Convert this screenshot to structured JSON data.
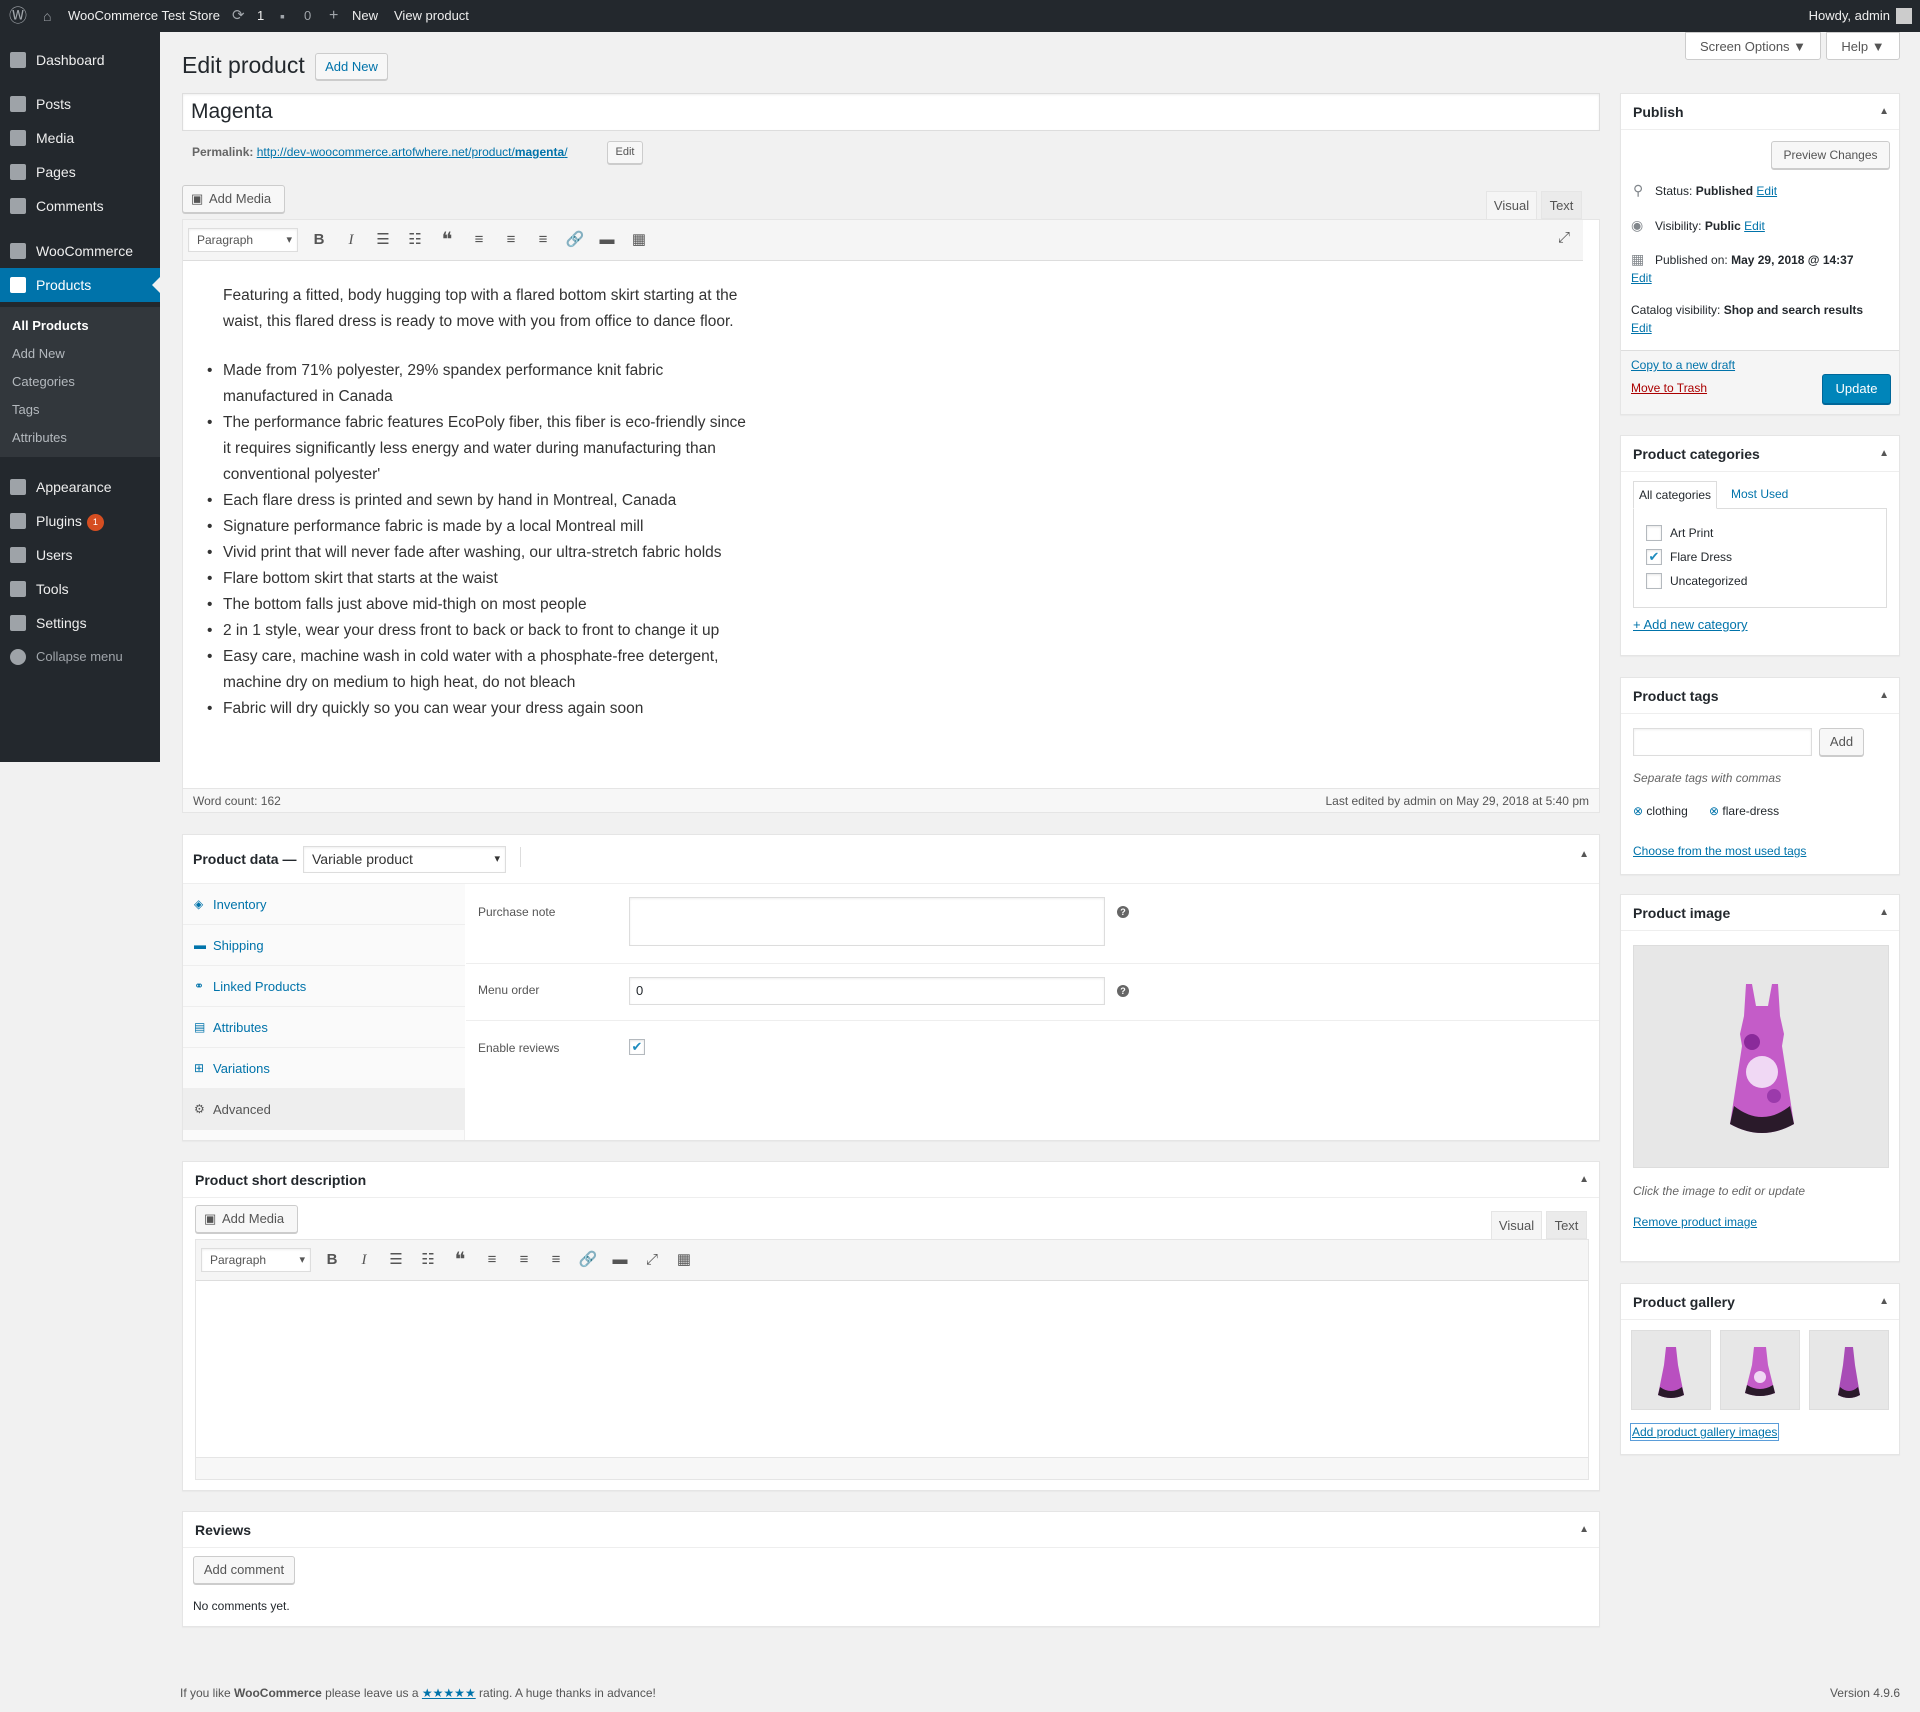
{
  "adminbar": {
    "wp_logo_icon": "wordpress-logo-icon",
    "site_name": "WooCommerce Test Store",
    "updates_count": "1",
    "comments_count": "0",
    "new_label": "New",
    "view_label": "View product",
    "howdy": "Howdy, admin"
  },
  "sidebar": {
    "items": [
      {
        "label": "Dashboard",
        "icon": "dashboard-icon"
      },
      {
        "label": "Posts",
        "icon": "pin-icon"
      },
      {
        "label": "Media",
        "icon": "media-icon"
      },
      {
        "label": "Pages",
        "icon": "pages-icon"
      },
      {
        "label": "Comments",
        "icon": "comments-icon"
      },
      {
        "label": "WooCommerce",
        "icon": "woocommerce-icon"
      },
      {
        "label": "Products",
        "icon": "products-icon"
      },
      {
        "label": "Appearance",
        "icon": "brush-icon"
      },
      {
        "label": "Plugins",
        "icon": "plugin-icon",
        "badge": "1"
      },
      {
        "label": "Users",
        "icon": "users-icon"
      },
      {
        "label": "Tools",
        "icon": "wrench-icon"
      },
      {
        "label": "Settings",
        "icon": "settings-icon"
      },
      {
        "label": "Collapse menu",
        "icon": "collapse-icon"
      }
    ],
    "submenu": [
      "All Products",
      "Add New",
      "Categories",
      "Tags",
      "Attributes"
    ]
  },
  "header": {
    "title": "Edit product",
    "add_new": "Add New",
    "screen_options": "Screen Options ▼",
    "help": "Help ▼"
  },
  "post": {
    "title": "Magenta",
    "permalink_label": "Permalink:",
    "permalink_base": "http://dev-woocommerce.artofwhere.net/product/",
    "permalink_slug": "magenta",
    "permalink_end": "/",
    "permalink_edit": "Edit"
  },
  "editor": {
    "add_media": "Add Media",
    "tab_visual": "Visual",
    "tab_text": "Text",
    "format": "Paragraph",
    "intro_line1": "Featuring a fitted, body hugging top with a flared bottom skirt starting at the",
    "intro_line2": "waist, this flared dress is ready to move with you from office to dance floor.",
    "bullets": [
      [
        "Made from 71% polyester, 29% spandex performance knit fabric",
        "manufactured in Canada"
      ],
      [
        "The performance fabric features EcoPoly fiber, this fiber is eco-friendly since",
        "it requires significantly less energy and water during manufacturing than",
        "conventional polyester'"
      ],
      [
        "Each flare dress is printed and sewn by hand in Montreal, Canada"
      ],
      [
        "Signature performance fabric is made by a local Montreal mill"
      ],
      [
        "Vivid print that will never fade after washing, our ultra-stretch fabric holds"
      ],
      [
        "Flare bottom skirt that starts at the waist"
      ],
      [
        "The bottom falls just above mid-thigh on most people"
      ],
      [
        "2 in 1 style, wear your dress front to back or back to front to change it up"
      ],
      [
        "Easy care, machine wash in cold water with a phosphate-free detergent,",
        "machine dry on medium to high heat, do not bleach"
      ],
      [
        "Fabric will dry quickly so you can wear your dress again soon"
      ]
    ],
    "word_count": "Word count: 162",
    "last_edited": "Last edited by admin on May 29, 2018 at 5:40 pm"
  },
  "product_data": {
    "label": "Product data —",
    "type": "Variable product",
    "tabs": [
      {
        "label": "Inventory",
        "icon": "tag-icon"
      },
      {
        "label": "Shipping",
        "icon": "truck-icon"
      },
      {
        "label": "Linked Products",
        "icon": "link-icon"
      },
      {
        "label": "Attributes",
        "icon": "list-icon"
      },
      {
        "label": "Variations",
        "icon": "grid-icon"
      },
      {
        "label": "Advanced",
        "icon": "gear-icon"
      }
    ],
    "purchase_note_label": "Purchase note",
    "purchase_note_value": "",
    "menu_order_label": "Menu order",
    "menu_order_value": "0",
    "enable_reviews_label": "Enable reviews",
    "enable_reviews": true
  },
  "short_desc": {
    "title": "Product short description",
    "add_media": "Add Media",
    "tab_visual": "Visual",
    "tab_text": "Text",
    "format": "Paragraph"
  },
  "reviews": {
    "title": "Reviews",
    "add_comment": "Add comment",
    "none": "No comments yet."
  },
  "publish": {
    "title": "Publish",
    "preview": "Preview Changes",
    "status_label": "Status:",
    "status": "Published",
    "visibility_label": "Visibility:",
    "visibility": "Public",
    "published_label": "Published on:",
    "published": "May 29, 2018 @ 14:37",
    "catalog_label": "Catalog visibility:",
    "catalog": "Shop and search results",
    "edit": "Edit",
    "copy": "Copy to a new draft",
    "trash": "Move to Trash",
    "update": "Update"
  },
  "categories": {
    "title": "Product categories",
    "tab_all": "All categories",
    "tab_most": "Most Used",
    "items": [
      {
        "label": "Art Print",
        "checked": false
      },
      {
        "label": "Flare Dress",
        "checked": true
      },
      {
        "label": "Uncategorized",
        "checked": false
      }
    ],
    "add_new": "+ Add new category"
  },
  "tags": {
    "title": "Product tags",
    "input_value": "",
    "add": "Add",
    "hint": "Separate tags with commas",
    "tags": [
      "clothing",
      "flare-dress"
    ],
    "choose": "Choose from the most used tags"
  },
  "image": {
    "title": "Product image",
    "hint": "Click the image to edit or update",
    "remove": "Remove product image"
  },
  "gallery": {
    "title": "Product gallery",
    "add": "Add product gallery images"
  },
  "footer": {
    "left_a": "If you like ",
    "left_b": "WooCommerce",
    "left_c": " please leave us a ",
    "stars": "★★★★★",
    "left_d": " rating. A huge thanks in advance!",
    "version": "Version 4.9.6"
  },
  "colors": {
    "accent": "#0073aa",
    "adminbar": "#23282d",
    "update": "#0085ba",
    "trash": "#a00",
    "badge": "#d54e21"
  }
}
